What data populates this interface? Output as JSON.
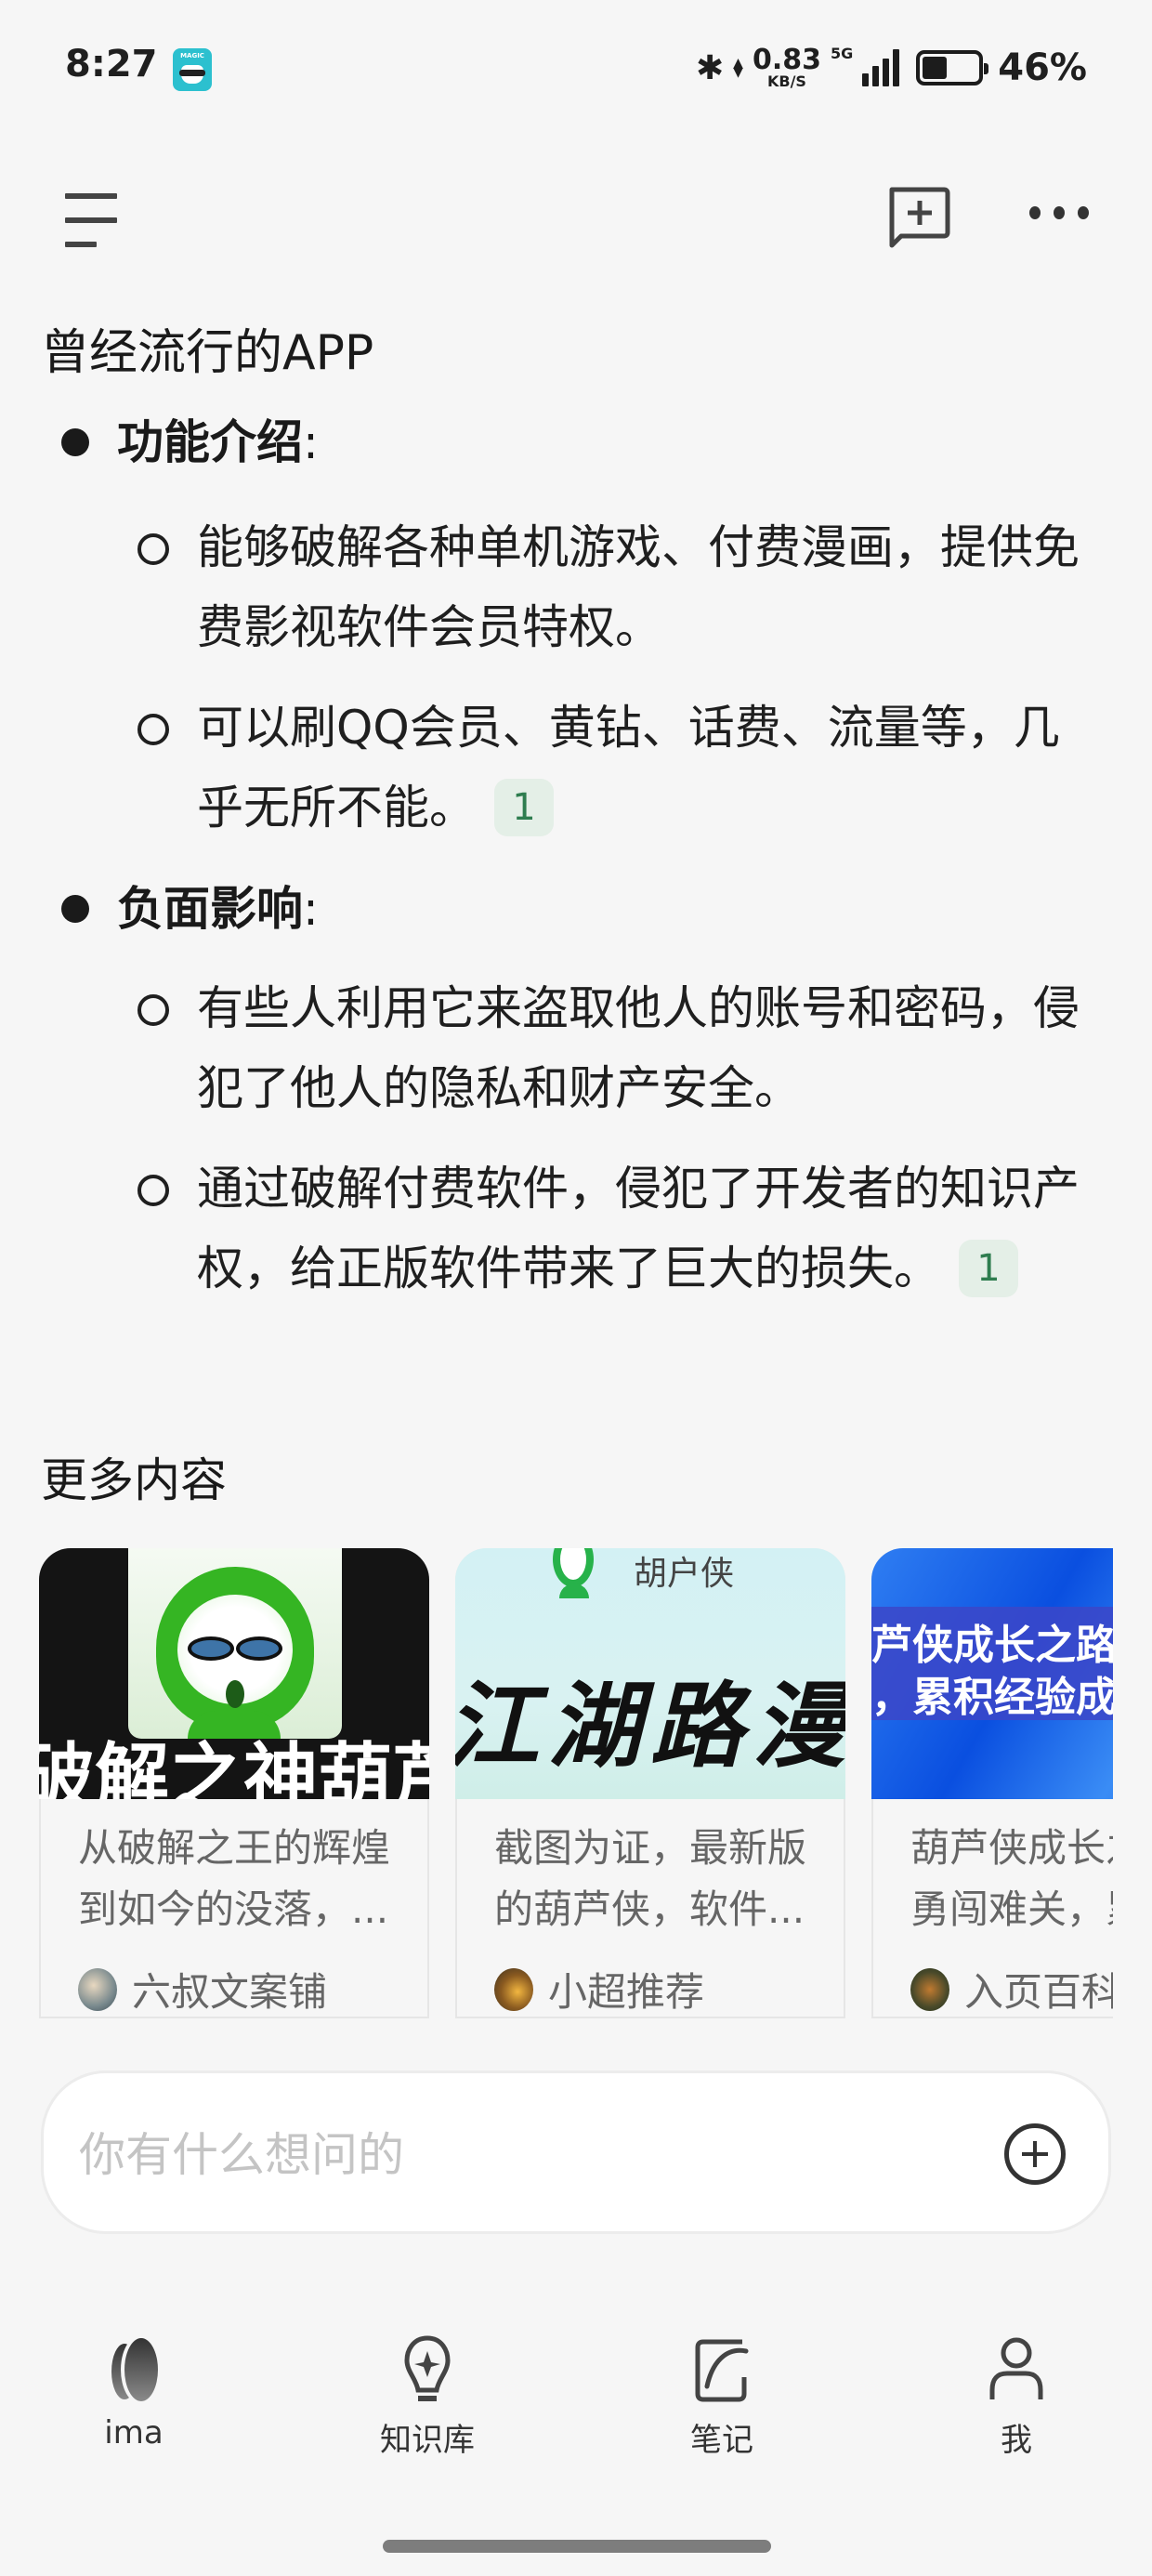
{
  "status_bar": {
    "time": "8:27",
    "app_badge_label": "MAGIC",
    "bluetooth_icon": "bluetooth-icon",
    "net_speed_value": "0.83",
    "net_speed_unit": "KB/S",
    "network_type": "5G",
    "signal_bars": 4,
    "battery_percent": 46,
    "battery_label": "46%"
  },
  "toolbar": {
    "menu_icon": "menu-icon",
    "new_chat_icon": "new-chat-icon",
    "more_icon": "more-icon"
  },
  "document": {
    "title": "曾经流行的APP",
    "sections": [
      {
        "heading": "功能介绍",
        "colon": ":",
        "items": [
          {
            "text": "能够破解各种单机游戏、付费漫画，提供免费影视软件会员特权。",
            "citation": null
          },
          {
            "text": "可以刷QQ会员、黄钻、话费、流量等，几乎无所不能。",
            "citation": "1"
          }
        ]
      },
      {
        "heading": "负面影响",
        "colon": ":",
        "items": [
          {
            "text": "有些人利用它来盗取他人的账号和密码，侵犯了他人的隐私和财产安全。",
            "citation": null
          },
          {
            "text": "通过破解付费软件，侵犯了开发者的知识产权，给正版软件带来了巨大的损失。",
            "citation": "1"
          }
        ]
      }
    ]
  },
  "more_content": {
    "title": "更多内容",
    "cards": [
      {
        "image_caption": "破解之神葫芦",
        "summary": "从破解之王的辉煌到如今的没落，...",
        "author": "六叔文案铺"
      },
      {
        "image_brand": "胡户侠",
        "image_caption": "江湖路漫漫",
        "summary": "截图为证，最新版的葫芦侠，软件...",
        "author": "小超推荐"
      },
      {
        "image_caption_line1": "芦侠成长之路",
        "image_caption_line2": "，累积经验成",
        "summary": "葫芦侠成长之路，勇闯难关，累",
        "author": "入页百科"
      }
    ]
  },
  "ask": {
    "placeholder": "你有什么想问的",
    "value": "",
    "add_icon": "plus-circle-icon"
  },
  "bottom_nav": {
    "items": [
      {
        "label": "ima",
        "icon": "ima-logo-icon"
      },
      {
        "label": "知识库",
        "icon": "bulb-sparkle-icon"
      },
      {
        "label": "笔记",
        "icon": "note-pen-icon"
      },
      {
        "label": "我",
        "icon": "person-icon"
      }
    ]
  },
  "colors": {
    "background": "#f6f6f6",
    "citation_bg": "#e4efe7",
    "citation_text": "#2e7d4f",
    "placeholder": "#c4c4c4"
  }
}
